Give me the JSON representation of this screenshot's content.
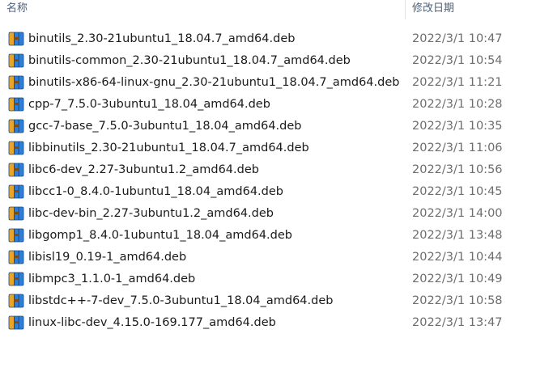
{
  "columns": {
    "name": "名称",
    "date": "修改日期"
  },
  "icon": "winrar-archive-icon",
  "files": [
    {
      "name": "binutils_2.30-21ubuntu1_18.04.7_amd64.deb",
      "date": "2022/3/1 10:47"
    },
    {
      "name": "binutils-common_2.30-21ubuntu1_18.04.7_amd64.deb",
      "date": "2022/3/1 10:54"
    },
    {
      "name": "binutils-x86-64-linux-gnu_2.30-21ubuntu1_18.04.7_amd64.deb",
      "date": "2022/3/1 11:21"
    },
    {
      "name": "cpp-7_7.5.0-3ubuntu1_18.04_amd64.deb",
      "date": "2022/3/1 10:28"
    },
    {
      "name": "gcc-7-base_7.5.0-3ubuntu1_18.04_amd64.deb",
      "date": "2022/3/1 10:35"
    },
    {
      "name": "libbinutils_2.30-21ubuntu1_18.04.7_amd64.deb",
      "date": "2022/3/1 11:06"
    },
    {
      "name": "libc6-dev_2.27-3ubuntu1.2_amd64.deb",
      "date": "2022/3/1 10:56"
    },
    {
      "name": "libcc1-0_8.4.0-1ubuntu1_18.04_amd64.deb",
      "date": "2022/3/1 10:45"
    },
    {
      "name": "libc-dev-bin_2.27-3ubuntu1.2_amd64.deb",
      "date": "2022/3/1 14:00"
    },
    {
      "name": "libgomp1_8.4.0-1ubuntu1_18.04_amd64.deb",
      "date": "2022/3/1 13:48"
    },
    {
      "name": "libisl19_0.19-1_amd64.deb",
      "date": "2022/3/1 10:44"
    },
    {
      "name": "libmpc3_1.1.0-1_amd64.deb",
      "date": "2022/3/1 10:49"
    },
    {
      "name": "libstdc++-7-dev_7.5.0-3ubuntu1_18.04_amd64.deb",
      "date": "2022/3/1 10:58"
    },
    {
      "name": "linux-libc-dev_4.15.0-169.177_amd64.deb",
      "date": "2022/3/1 13:47"
    }
  ]
}
